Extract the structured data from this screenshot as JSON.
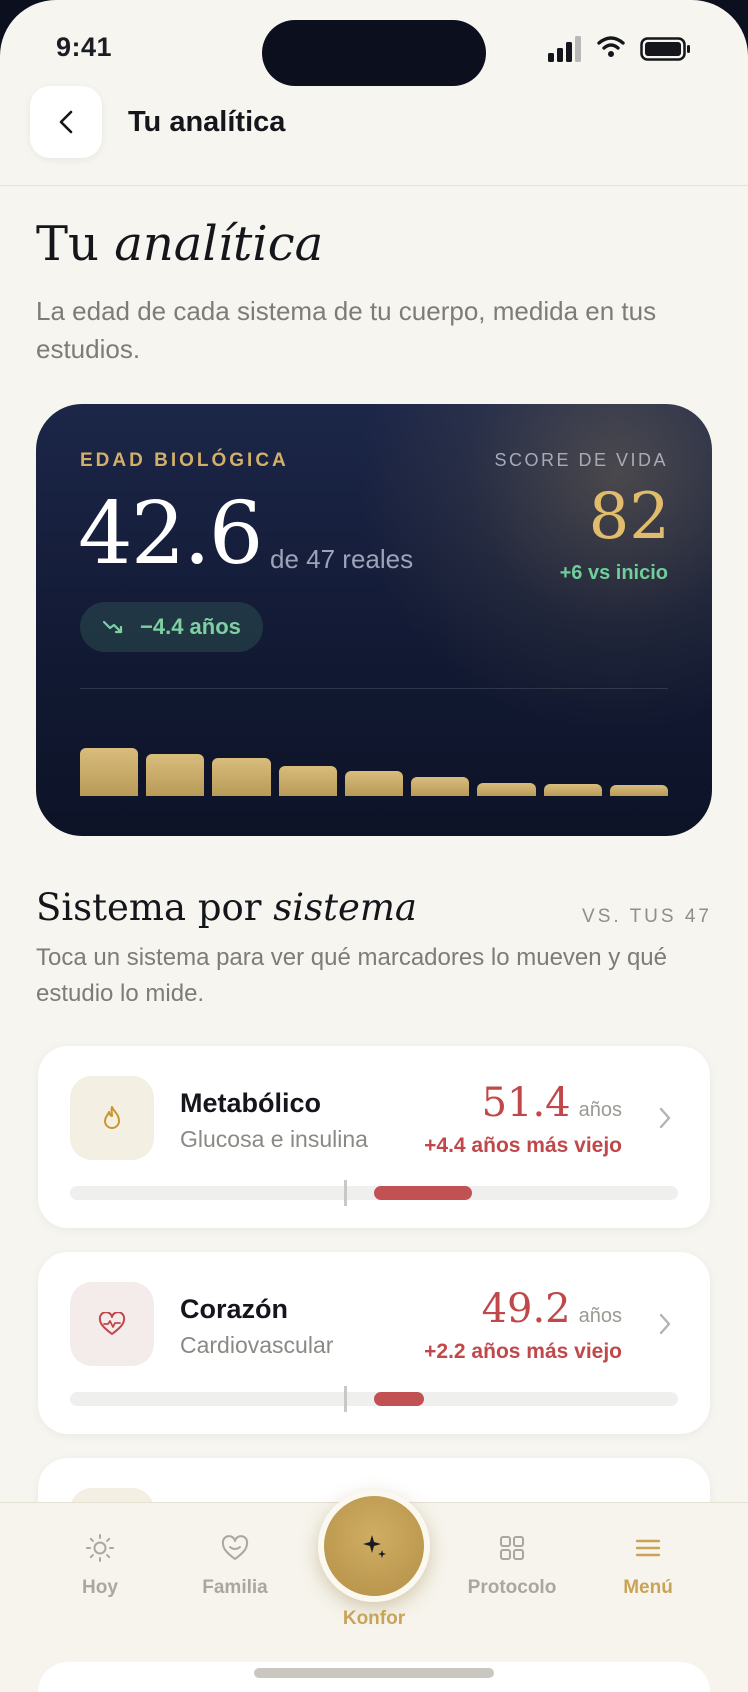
{
  "status": {
    "time": "9:41"
  },
  "header": {
    "title": "Tu analítica"
  },
  "page": {
    "title_plain": "Tu",
    "title_italic": "analítica",
    "subtitle": "La edad de cada sistema de tu cuerpo, medida en tus estudios."
  },
  "hero": {
    "bio_label": "EDAD BIOLÓGICA",
    "bio_value": "42.6",
    "bio_real": "de 47 reales",
    "delta": "−4.4 años",
    "score_label": "SCORE DE VIDA",
    "score_value": "82",
    "score_delta": "+6 vs inicio",
    "trend_bars": [
      1.0,
      0.88,
      0.8,
      0.62,
      0.52,
      0.4,
      0.28,
      0.24,
      0.22
    ]
  },
  "section": {
    "title_plain": "Sistema por",
    "title_italic": "sistema",
    "vs": "VS. TUS 47",
    "subtitle": "Toca un sistema para ver qué marcadores lo mueven y qué estudio lo mide."
  },
  "systems": [
    {
      "name": "Metabólico",
      "desc": "Glucosa e insulina",
      "age": "51.4",
      "unit": "años",
      "diff": "+4.4 años más viejo",
      "icon": "flame-icon",
      "color": "#c0484a"
    },
    {
      "name": "Corazón",
      "desc": "Cardiovascular",
      "age": "49.2",
      "unit": "años",
      "diff": "+2.2 años más viejo",
      "icon": "heart-pulse-icon",
      "color": "#c0484a"
    }
  ],
  "nav": {
    "items": [
      {
        "label": "Hoy",
        "icon": "sun-icon"
      },
      {
        "label": "Familia",
        "icon": "heart-icon"
      },
      {
        "label": "Konfor",
        "icon": "sparkle-icon"
      },
      {
        "label": "Protocolo",
        "icon": "grid-icon"
      },
      {
        "label": "Menú",
        "icon": "menu-icon"
      }
    ],
    "active": "Menú"
  }
}
